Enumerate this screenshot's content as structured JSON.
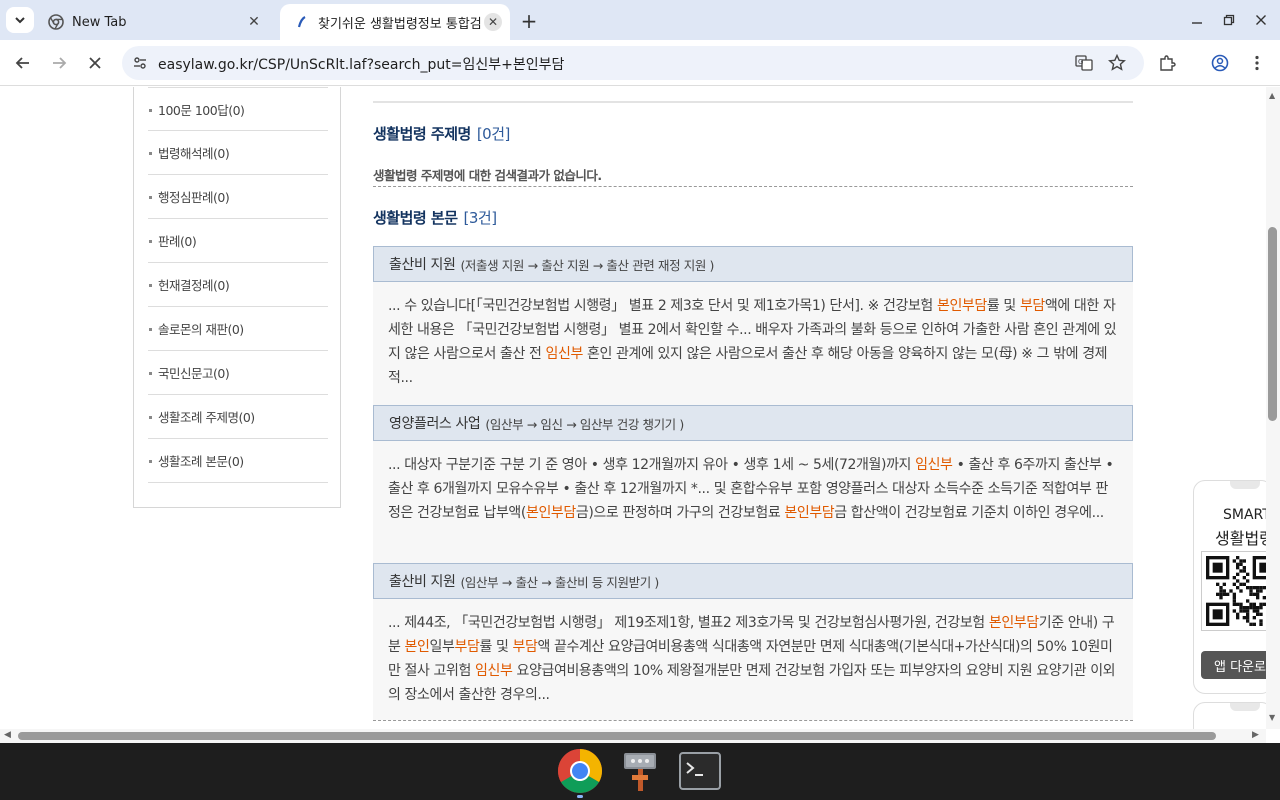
{
  "browser": {
    "tabs": [
      {
        "title": "New Tab"
      },
      {
        "title": "찾기쉬운 생활법령정보 통합검"
      }
    ],
    "url": "easylaw.go.kr/CSP/UnScRlt.laf?search_put=임신부+본인부담"
  },
  "sidebar": {
    "items": [
      {
        "label": "100문 100답(0)"
      },
      {
        "label": "법령해석례(0)"
      },
      {
        "label": "행정심판례(0)"
      },
      {
        "label": "판례(0)"
      },
      {
        "label": "헌재결정례(0)"
      },
      {
        "label": "솔로몬의 재판(0)"
      },
      {
        "label": "국민신문고(0)"
      },
      {
        "label": "생활조례 주제명(0)"
      },
      {
        "label": "생활조례 본문(0)"
      }
    ]
  },
  "main": {
    "topic_section": {
      "title": "생활법령 주제명",
      "count": "[0건]",
      "no_result": "생활법령 주제명에 대한 검색결과가 없습니다."
    },
    "body_section": {
      "title": "생활법령 본문",
      "count": "[3건]"
    },
    "results": [
      {
        "title": "출산비 지원",
        "path": "(저출생 지원 → 출산 지원 → 출산 관련 재정 지원 )",
        "segments": [
          {
            "t": "... 수 있습니다[「국민건강보험법 시행령」 별표 2 제3호 단서 및 제1호가목1) 단서]. ※ 건강보험 "
          },
          {
            "t": "본인부담",
            "hl": true
          },
          {
            "t": "률 및 "
          },
          {
            "t": "부담",
            "hl": true
          },
          {
            "t": "액에 대한 자세한 내용은 「국민건강보험법 시행령」 별표 2에서 확인할 수... 배우자 가족과의 불화 등으로 인하여 가출한 사람 혼인 관계에 있지 않은 사람으로서 출산 전 "
          },
          {
            "t": "임신부",
            "hl": true
          },
          {
            "t": " 혼인 관계에 있지 않은 사람으로서 출산 후 해당 아동을 양육하지 않는 모(母) ※ 그 밖에 경제적..."
          }
        ]
      },
      {
        "title": "영양플러스 사업",
        "path": "(임산부 → 임신 → 임산부 건강 챙기기 )",
        "segments": [
          {
            "t": "... 대상자 구분기준 구분 기 준 영아 • 생후 12개월까지 유아 • 생후 1세 ~ 5세(72개월)까지 "
          },
          {
            "t": "임신부",
            "hl": true
          },
          {
            "t": " • 출산 후 6주까지 출산부 • 출산 후 6개월까지 모유수유부 • 출산 후 12개월까지 *... 및 혼합수유부 포함 영양플러스 대상자 소득수준 소득기준 적합여부 판정은 건강보험료 납부액("
          },
          {
            "t": "본인부담",
            "hl": true
          },
          {
            "t": "금)으로 판정하며 가구의 건강보험료 "
          },
          {
            "t": "본인부담",
            "hl": true
          },
          {
            "t": "금 합산액이 건강보험료 기준치 이하인 경우에..."
          }
        ]
      },
      {
        "title": "출산비 지원",
        "path": "(임산부 → 출산 → 출산비 등 지원받기 )",
        "segments": [
          {
            "t": "... 제44조, 「국민건강보험법 시행령」 제19조제1항, 별표2 제3호가목 및 건강보험심사평가원, 건강보험 "
          },
          {
            "t": "본인부담",
            "hl": true
          },
          {
            "t": "기준 안내) 구분 "
          },
          {
            "t": "본인",
            "hl": true
          },
          {
            "t": "일부"
          },
          {
            "t": "부담",
            "hl": true
          },
          {
            "t": "률 및 "
          },
          {
            "t": "부담",
            "hl": true
          },
          {
            "t": "액 끝수계산 요양급여비용총액 식대총액 자연분만 면제 식대총액(기본식대+가산식대)의 50% 10원미만 절사 고위험 "
          },
          {
            "t": "임신부",
            "hl": true
          },
          {
            "t": " 요양급여비용총액의 10% 제왕절개분만 면제 건강보험 가입자 또는 피부양자의 요양비 지원 요양기관 이외의 장소에서 출산한 경우의..."
          }
        ]
      }
    ]
  },
  "smart_panel": {
    "line1": "SMART",
    "line2": "생활법령",
    "button": "앱 다운로드"
  },
  "colors": {
    "highlight": "#e05a00",
    "section_title": "#13335f",
    "result_head_bg": "#dfe6ef"
  }
}
